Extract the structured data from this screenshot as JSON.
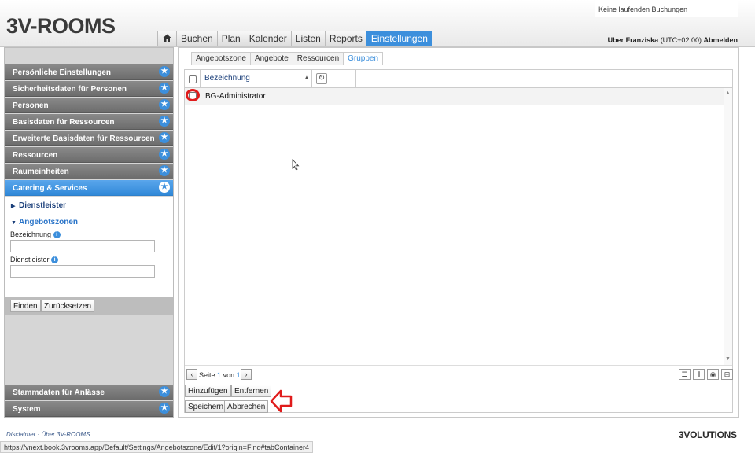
{
  "header": {
    "logo_prefix": "3",
    "logo_text": "V-ROOMS",
    "booking_status": "Keine laufenden Buchungen",
    "nav": [
      "Buchen",
      "Plan",
      "Kalender",
      "Listen",
      "Reports",
      "Einstellungen"
    ],
    "nav_active": "Einstellungen",
    "user_name": "Uber Franziska",
    "timezone": "(UTC+02:00)",
    "logout": "Abmelden"
  },
  "sidebar": {
    "items": [
      {
        "label": "Persönliche Einstellungen"
      },
      {
        "label": "Sicherheitsdaten für Personen"
      },
      {
        "label": "Personen"
      },
      {
        "label": "Basisdaten für Ressourcen"
      },
      {
        "label": "Erweiterte Basisdaten für Ressourcen"
      },
      {
        "label": "Ressourcen"
      },
      {
        "label": "Raumeinheiten"
      },
      {
        "label": "Catering & Services"
      }
    ],
    "sub_links": [
      "Dienstleister",
      "Angebotszonen"
    ],
    "fields": [
      {
        "label": "Bezeichnung",
        "value": ""
      },
      {
        "label": "Dienstleister",
        "value": ""
      }
    ],
    "find_button": "Finden",
    "reset_button": "Zurücksetzen",
    "bottom_items": [
      {
        "label": "Stammdaten für Anlässe"
      },
      {
        "label": "System"
      }
    ]
  },
  "main": {
    "tabs": [
      "Angebotszone",
      "Angebote",
      "Ressourcen",
      "Gruppen"
    ],
    "active_tab": "Gruppen",
    "column_header": "Bezeichnung",
    "rows": [
      {
        "label": "BG-Administrator"
      }
    ],
    "pager": {
      "prefix": "Seite",
      "current": "1",
      "of": "von",
      "total": "1"
    },
    "buttons": {
      "add": "Hinzufügen",
      "remove": "Entfernen",
      "save": "Speichern",
      "cancel": "Abbrechen"
    }
  },
  "footer": {
    "disclaimer": "Disclaimer",
    "separator": "·",
    "about": "Über 3V-ROOMS",
    "logo": "3VOLUTIONS",
    "status_url": "https://vnext.book.3vrooms.app/Default/Settings/Angebotszone/Edit/1?origin=Find#tabContainer4"
  },
  "colors": {
    "accent": "#3c8fdc",
    "annotation": "#e01b1b"
  }
}
